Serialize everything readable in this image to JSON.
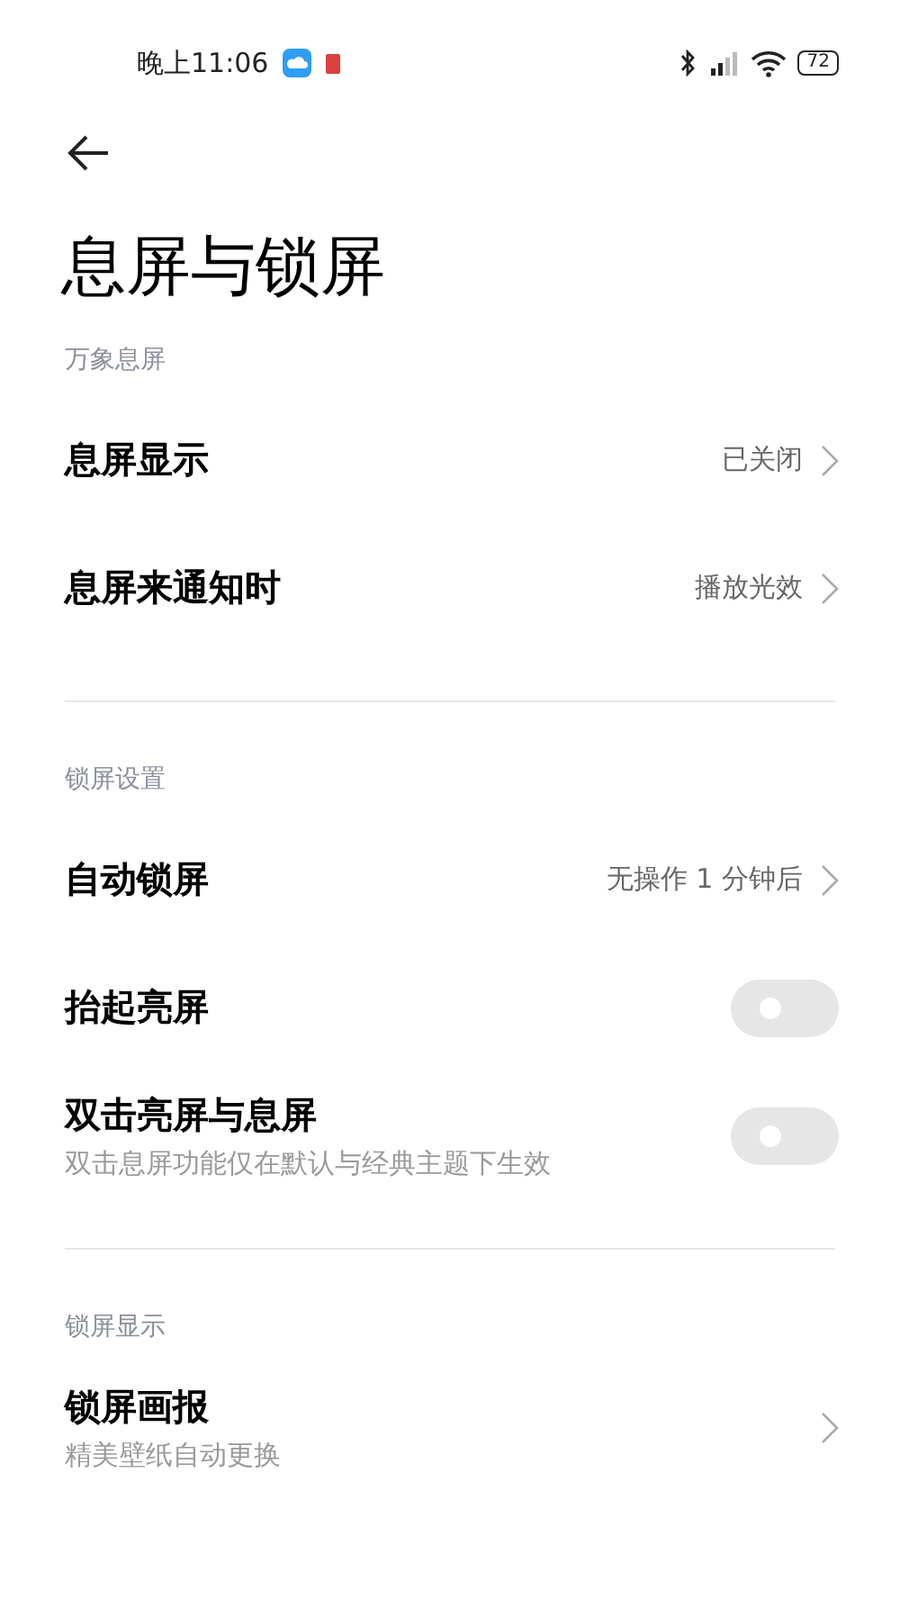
{
  "status_bar": {
    "time": "晚上11:06",
    "battery": "72"
  },
  "title": "息屏与锁屏",
  "sections": [
    {
      "header": "万象息屏",
      "items": [
        {
          "kind": "link",
          "title": "息屏显示",
          "value": "已关闭"
        },
        {
          "kind": "link",
          "title": "息屏来通知时",
          "value": "播放光效"
        }
      ]
    },
    {
      "header": "锁屏设置",
      "items": [
        {
          "kind": "link",
          "title": "自动锁屏",
          "value": "无操作 1 分钟后"
        },
        {
          "kind": "toggle",
          "title": "抬起亮屏",
          "on": false
        },
        {
          "kind": "toggle",
          "title": "双击亮屏与息屏",
          "subtitle": "双击息屏功能仅在默认与经典主题下生效",
          "on": false
        }
      ]
    },
    {
      "header": "锁屏显示",
      "items": [
        {
          "kind": "link",
          "title": "锁屏画报",
          "subtitle": "精美壁纸自动更换"
        }
      ]
    }
  ]
}
